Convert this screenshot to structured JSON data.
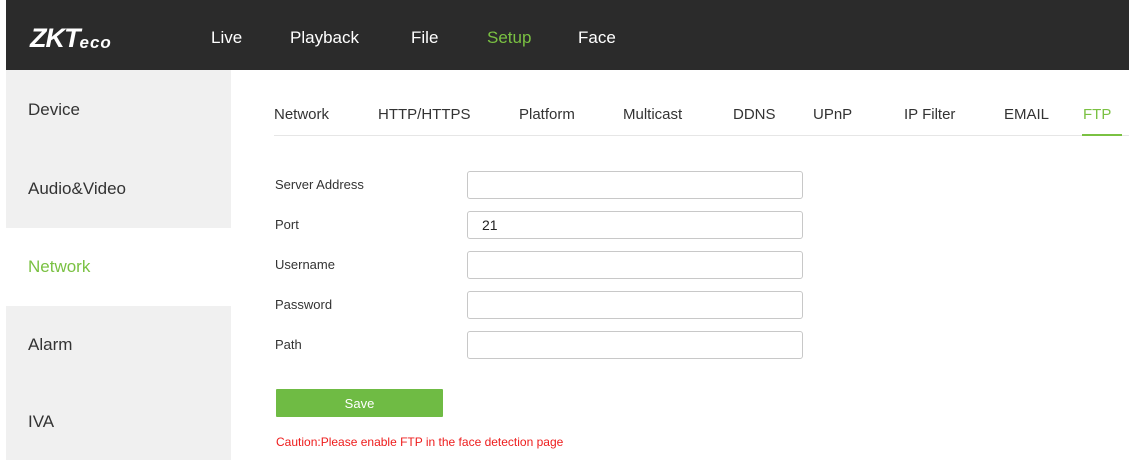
{
  "brand": {
    "logo_main": "ZKT",
    "logo_suffix": "eco"
  },
  "topnav": {
    "items": [
      "Live",
      "Playback",
      "File",
      "Setup",
      "Face"
    ],
    "active": "Setup"
  },
  "sidebar": {
    "items": [
      "Device",
      "Audio&Video",
      "Network",
      "Alarm",
      "IVA"
    ],
    "active": "Network"
  },
  "tabs": {
    "items": [
      "Network",
      "HTTP/HTTPS",
      "Platform",
      "Multicast",
      "DDNS",
      "UPnP",
      "IP Filter",
      "EMAIL",
      "FTP"
    ],
    "active": "FTP"
  },
  "form": {
    "server_address": {
      "label": "Server Address",
      "value": ""
    },
    "port": {
      "label": "Port",
      "value": "21"
    },
    "username": {
      "label": "Username",
      "value": ""
    },
    "password": {
      "label": "Password",
      "value": ""
    },
    "path": {
      "label": "Path",
      "value": ""
    }
  },
  "save_label": "Save",
  "caution": "Caution:Please enable FTP in the face detection page",
  "colors": {
    "accent": "#7ac142",
    "topbar": "#2b2b2b",
    "sidebar": "#f0f0f0",
    "caution": "#ee1c1c"
  }
}
